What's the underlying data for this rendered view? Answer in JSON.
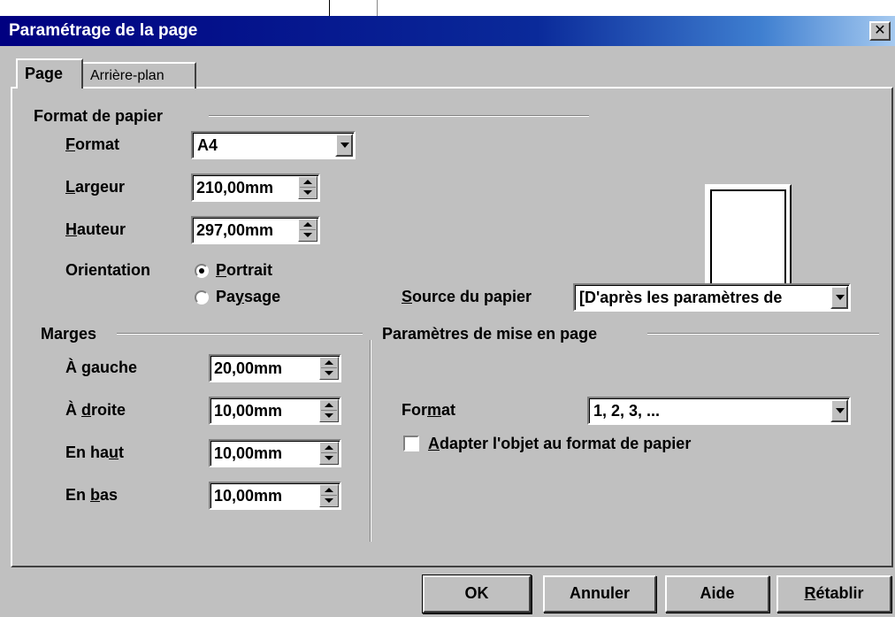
{
  "window": {
    "title": "Paramétrage de la page",
    "close_glyph": "✕"
  },
  "tabs": [
    {
      "label": "Page",
      "active": true
    },
    {
      "label": "Arrière-plan",
      "active": false
    }
  ],
  "paper_format": {
    "group_title": "Format de papier",
    "format": {
      "label_pre": "",
      "label_accel": "F",
      "label_post": "ormat",
      "value": "A4"
    },
    "width": {
      "label_pre": "",
      "label_accel": "L",
      "label_post": "argeur",
      "value": "210,00mm"
    },
    "height": {
      "label_pre": "",
      "label_accel": "H",
      "label_post": "auteur",
      "value": "297,00mm"
    },
    "orientation": {
      "label": "Orientation",
      "portrait": {
        "label_pre": "",
        "label_accel": "P",
        "label_post": "ortrait",
        "checked": true
      },
      "landscape": {
        "label_pre": "Pa",
        "label_accel": "y",
        "label_post": "sage",
        "checked": false
      }
    },
    "source": {
      "label_pre": "",
      "label_accel": "S",
      "label_post": "ource du papier",
      "value": "[D'après les paramètres de"
    }
  },
  "margins": {
    "group_title": "Marges",
    "left": {
      "label_pre": "À ",
      "label_accel": "g",
      "label_post": "auche",
      "value": "20,00mm"
    },
    "right": {
      "label_pre": "À ",
      "label_accel": "d",
      "label_post": "roite",
      "value": "10,00mm"
    },
    "top": {
      "label_pre": "En ha",
      "label_accel": "u",
      "label_post": "t",
      "value": "10,00mm"
    },
    "bottom": {
      "label_pre": "En ",
      "label_accel": "b",
      "label_post": "as",
      "value": "10,00mm"
    }
  },
  "layout_settings": {
    "group_title": "Paramètres de mise en page",
    "format": {
      "label_pre": "For",
      "label_accel": "m",
      "label_post": "at",
      "value": "1, 2, 3, ..."
    },
    "fit_object": {
      "label_pre": "",
      "label_accel": "A",
      "label_post": "dapter l'objet au format de papier",
      "checked": false
    }
  },
  "buttons": {
    "ok": "OK",
    "cancel": "Annuler",
    "help": "Aide",
    "reset": {
      "label_pre": "",
      "label_accel": "R",
      "label_post": "établir"
    }
  },
  "colors": {
    "titlebar_start": "#000080",
    "titlebar_end": "#a6caf0",
    "face": "#c0c0c0"
  }
}
